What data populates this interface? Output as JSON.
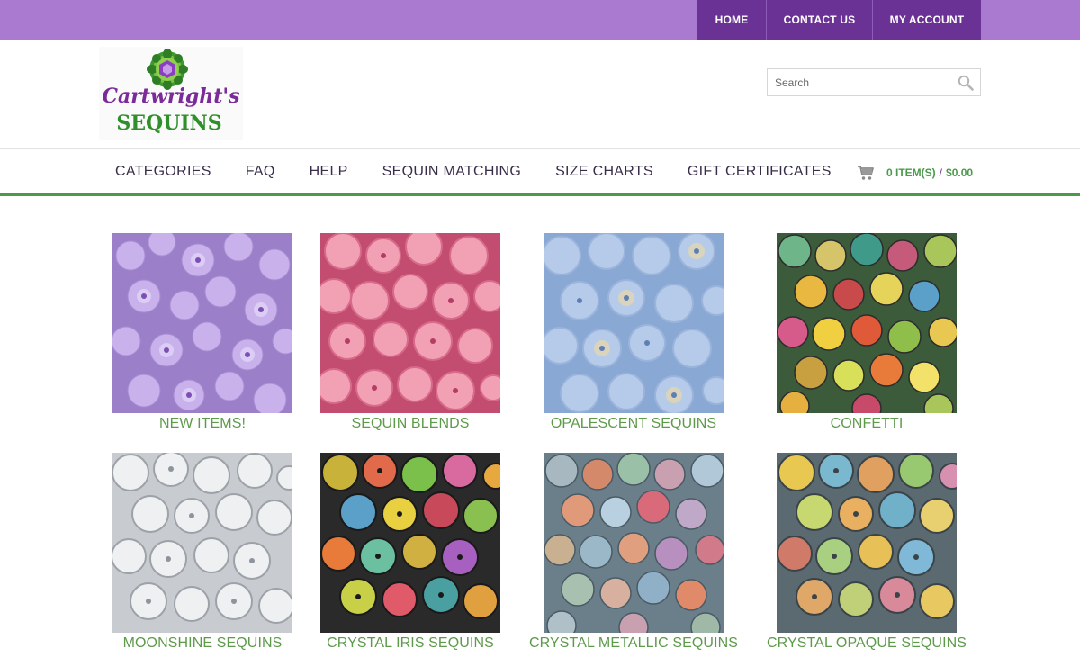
{
  "topnav": {
    "home": "HOME",
    "contact": "CONTACT US",
    "account": "MY ACCOUNT"
  },
  "logo": {
    "line1": "Cartwright's",
    "line2": "SEQUINS"
  },
  "search": {
    "placeholder": "Search",
    "value": ""
  },
  "nav": {
    "items": [
      "CATEGORIES",
      "FAQ",
      "HELP",
      "SEQUIN MATCHING",
      "SIZE CHARTS",
      "GIFT CERTIFICATES"
    ]
  },
  "cart": {
    "count": "0 ITEM(S)",
    "separator": "/",
    "total": "$0.00"
  },
  "categories": [
    {
      "label": "NEW ITEMS!"
    },
    {
      "label": "SEQUIN BLENDS"
    },
    {
      "label": "OPALESCENT SEQUINS"
    },
    {
      "label": "CONFETTI"
    },
    {
      "label": "MOONSHINE SEQUINS"
    },
    {
      "label": "CRYSTAL IRIS SEQUINS"
    },
    {
      "label": "CRYSTAL METALLIC SEQUINS"
    },
    {
      "label": "CRYSTAL OPAQUE SEQUINS"
    }
  ],
  "colors": {
    "topbar": "#a97ad0",
    "topnav": "#6a3294",
    "accent_green": "#4b9a4b",
    "caption_green": "#5d9a4a"
  }
}
